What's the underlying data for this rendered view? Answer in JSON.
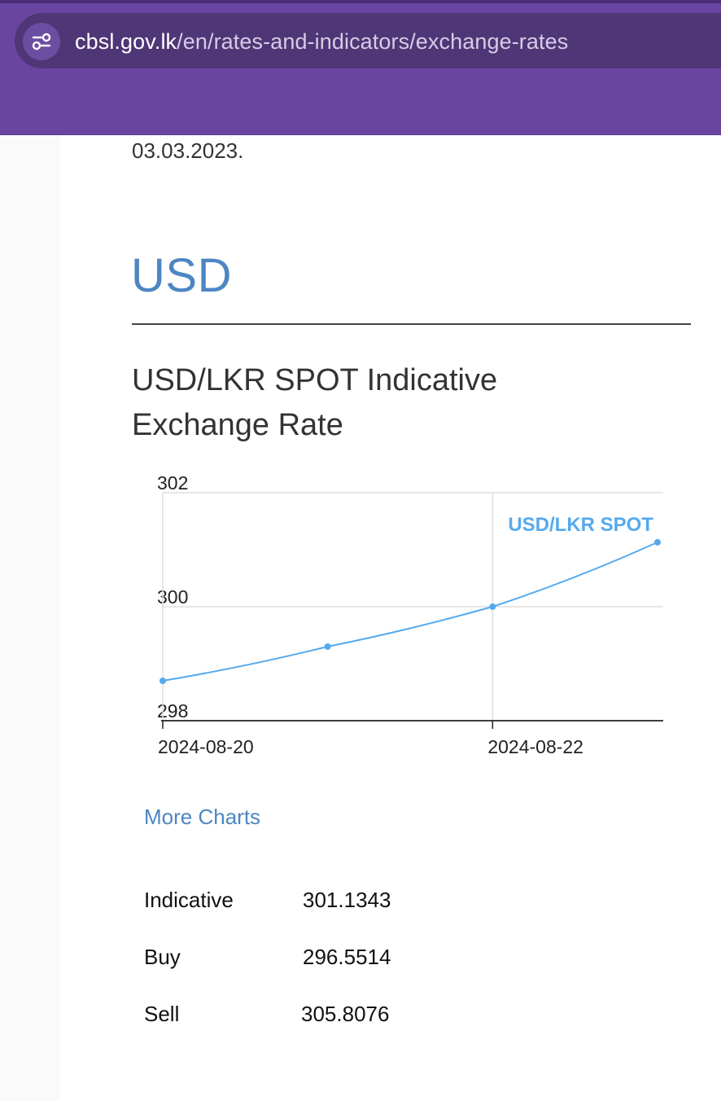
{
  "browser": {
    "url_host": "cbsl.gov.lk",
    "url_path": "/en/rates-and-indicators/exchange-rates",
    "site_info_icon": "tune-icon"
  },
  "page": {
    "previous_date_text": "03.03.2023.",
    "currency_heading": "USD",
    "chart_heading": "USD/LKR SPOT Indicative Exchange Rate",
    "more_charts_link": "More Charts",
    "accent_color": "#4d86c3",
    "header_color": "#6a44a1"
  },
  "chart_data": {
    "type": "line",
    "title": "",
    "xlabel": "",
    "ylabel": "",
    "x": [
      "2024-08-20",
      "2024-08-21",
      "2024-08-22",
      "2024-08-23"
    ],
    "x_ticks": [
      "2024-08-20",
      "2024-08-22"
    ],
    "ylim": [
      298,
      302
    ],
    "y_ticks": [
      "298",
      "300",
      "302"
    ],
    "series": [
      {
        "name": "USD/LKR SPOT",
        "values": [
          298.7,
          299.3,
          300.0,
          301.13
        ],
        "color": "#55aaee"
      }
    ],
    "grid": true,
    "legend": "top-right"
  },
  "rates": [
    {
      "label": "Indicative",
      "value": "301.1343"
    },
    {
      "label": "Buy",
      "value": "296.5514"
    },
    {
      "label": "Sell",
      "value": "305.8076"
    }
  ]
}
